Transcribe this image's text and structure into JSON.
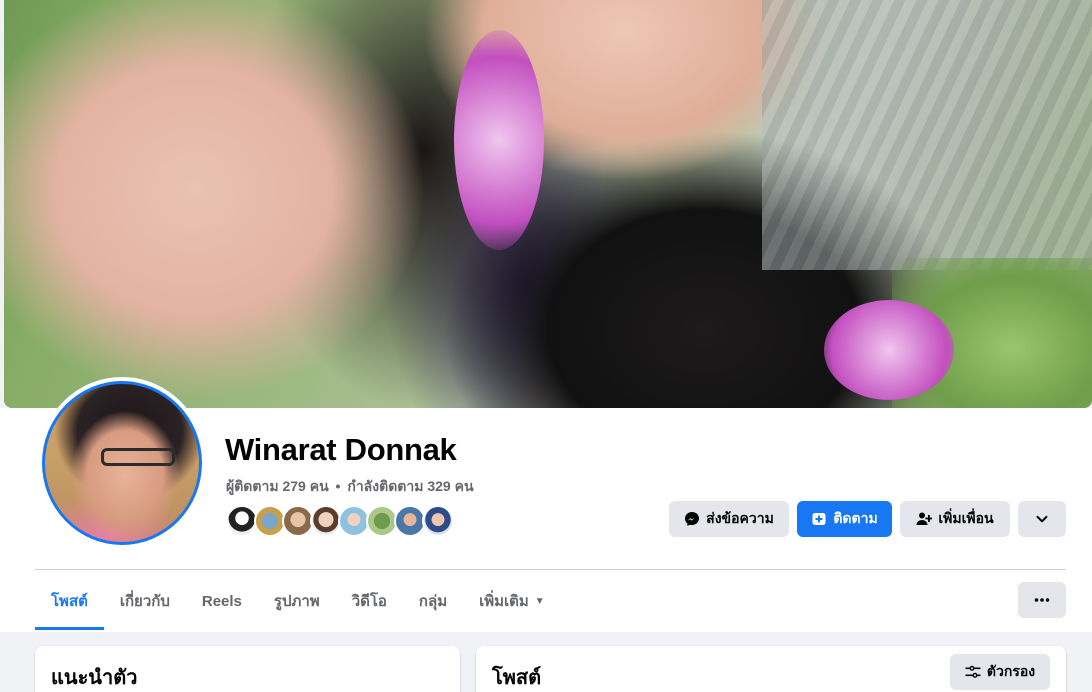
{
  "profile": {
    "name": "Winarat Donnak",
    "followers_label": "ผู้ติดตาม 279 คน",
    "separator": "•",
    "following_label": "กำลังติดตาม 329 คน",
    "mutual_friend_avatars": [
      "friend-avatar-1",
      "friend-avatar-2",
      "friend-avatar-3",
      "friend-avatar-4",
      "friend-avatar-5",
      "friend-avatar-6",
      "friend-avatar-7",
      "friend-avatar-8"
    ]
  },
  "actions": {
    "message_label": "ส่งข้อความ",
    "follow_label": "ติดตาม",
    "add_friend_label": "เพิ่มเพื่อน"
  },
  "tabs": [
    {
      "label": "โพสต์",
      "active": true
    },
    {
      "label": "เกี่ยวกับ",
      "active": false
    },
    {
      "label": "Reels",
      "active": false
    },
    {
      "label": "รูปภาพ",
      "active": false
    },
    {
      "label": "วิดีโอ",
      "active": false
    },
    {
      "label": "กลุ่ม",
      "active": false
    },
    {
      "label": "เพิ่มเติม",
      "active": false
    }
  ],
  "intro": {
    "title": "แนะนำตัว"
  },
  "posts": {
    "title": "โพสต์",
    "filter_label": "ตัวกรอง"
  },
  "colors": {
    "accent": "#1877f2",
    "background": "#f0f2f5",
    "muted_text": "#65676b",
    "button_gray": "#e4e6eb"
  }
}
